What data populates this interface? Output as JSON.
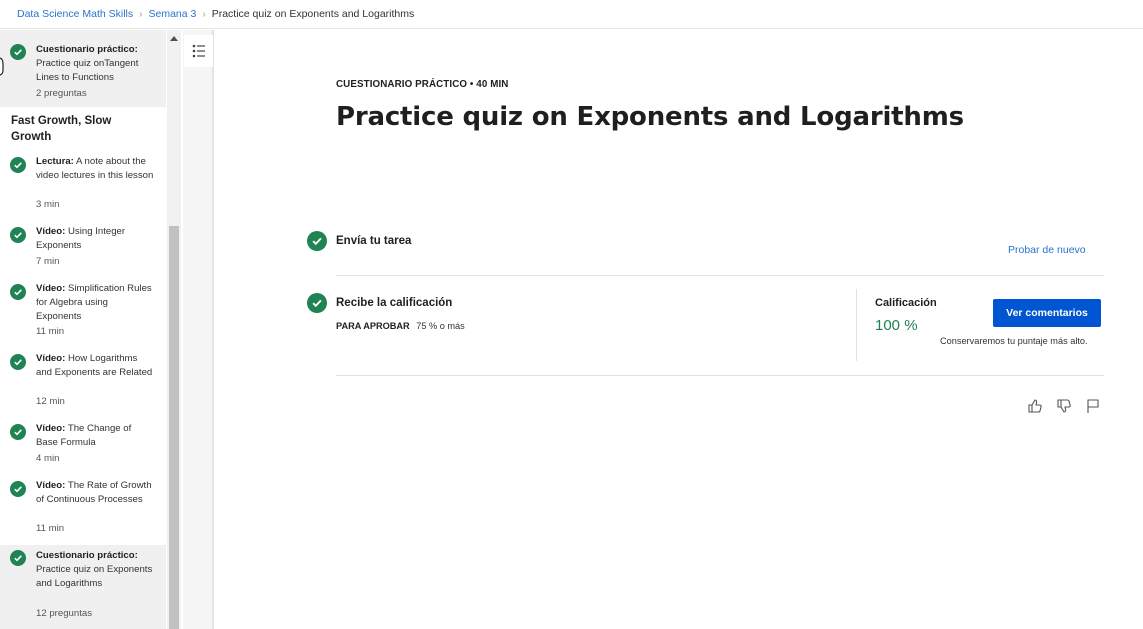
{
  "breadcrumb": {
    "items": [
      "Data Science Math Skills",
      "Semana 3",
      "Practice quiz on Exponents and Logarithms"
    ]
  },
  "sidebar": {
    "section_title": "Fast Growth, Slow Growth",
    "items": [
      {
        "type": "Cuestionario práctico:",
        "title": "Practice quiz onTangent Lines to Functions",
        "meta": "2 preguntas",
        "completed": true,
        "active": true
      },
      {
        "type": "Lectura:",
        "title": "A note about the video lectures in this lesson",
        "meta": "3 min",
        "completed": true,
        "active": false
      },
      {
        "type": "Vídeo:",
        "title": "Using Integer Exponents",
        "meta": "7 min",
        "completed": true,
        "active": false
      },
      {
        "type": "Vídeo:",
        "title": "Simplification Rules for Algebra using Exponents",
        "meta": "11 min",
        "completed": true,
        "active": false
      },
      {
        "type": "Vídeo:",
        "title": "How Logarithms and Exponents are Related",
        "meta": "12 min",
        "completed": true,
        "active": false
      },
      {
        "type": "Vídeo:",
        "title": "The Change of Base Formula",
        "meta": "4 min",
        "completed": true,
        "active": false
      },
      {
        "type": "Vídeo:",
        "title": "The Rate of Growth of Continuous Processes",
        "meta": "11 min",
        "completed": true,
        "active": false
      },
      {
        "type": "Cuestionario práctico:",
        "title": "Practice quiz on Exponents and Logarithms",
        "meta": "12 preguntas",
        "completed": true,
        "active": true
      }
    ]
  },
  "main": {
    "overline": "CUESTIONARIO PRÁCTICO • 40 MIN",
    "title": "Practice quiz on Exponents and Logarithms",
    "submit_step": {
      "label": "Envía tu tarea",
      "retry_label": "Probar de nuevo"
    },
    "grade_step": {
      "label": "Recibe la calificación",
      "pass_label": "PARA APROBAR",
      "pass_value": "75 % o más",
      "grade_label": "Calificación",
      "grade_value": "100 %",
      "feedback_button": "Ver comentarios",
      "keep_note": "Conservaremos tu puntaje más alto."
    }
  },
  "colors": {
    "accent_blue": "#0056d2",
    "link_blue": "#2a73cc",
    "success_green": "#1f8354"
  },
  "icons": [
    "check-circle-icon",
    "list-icon",
    "thumbs-up-icon",
    "thumbs-down-icon",
    "flag-icon"
  ]
}
